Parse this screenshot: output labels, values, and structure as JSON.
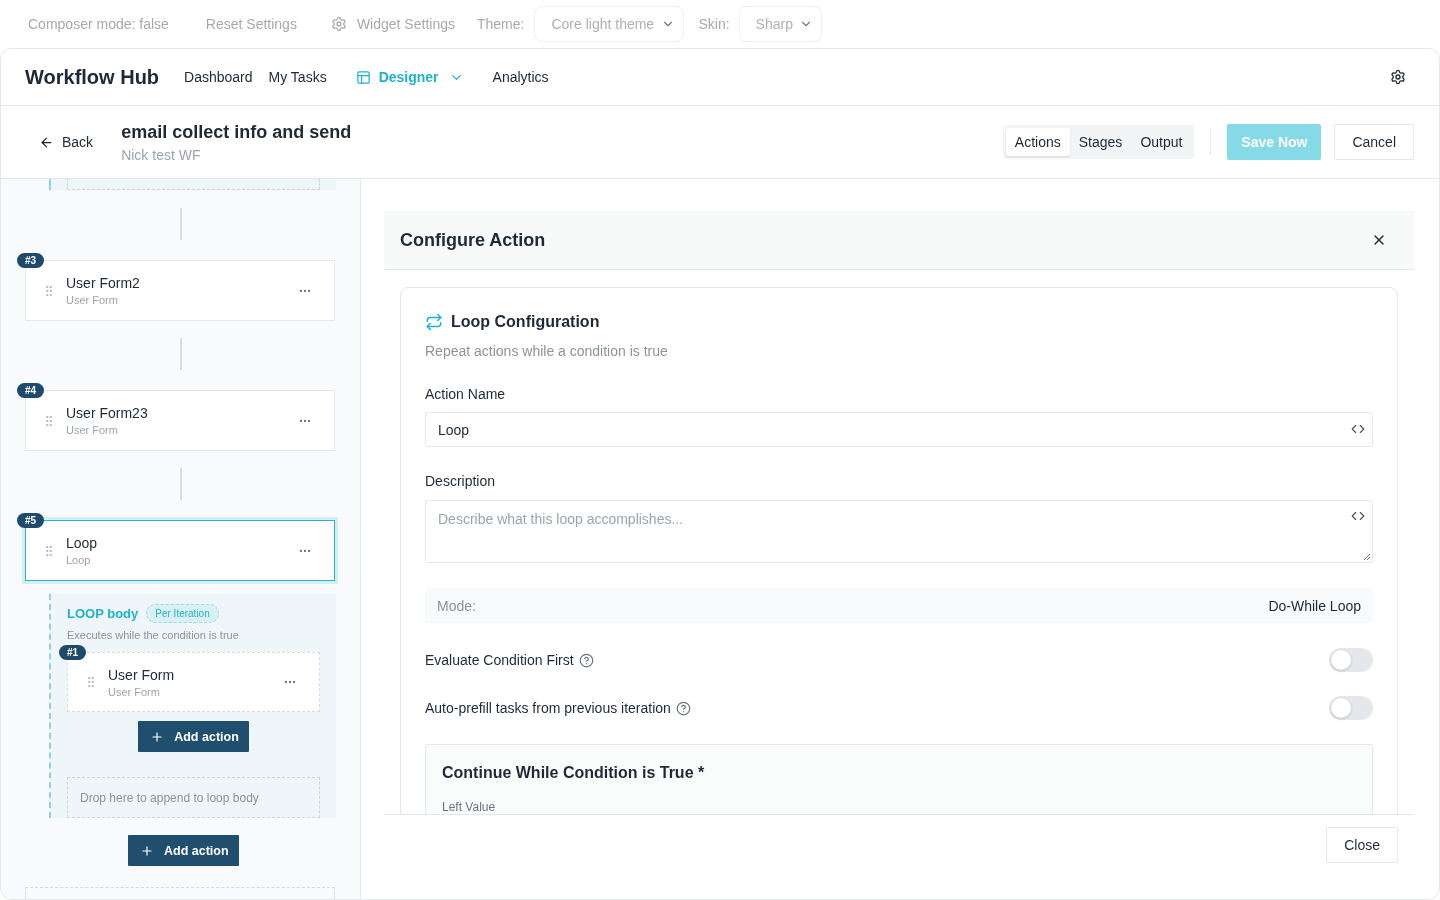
{
  "toolbar": {
    "composer_mode": "Composer mode: false",
    "reset": "Reset Settings",
    "widget_settings": "Widget Settings",
    "theme_label": "Theme:",
    "theme_value": "Core light theme",
    "skin_label": "Skin:",
    "skin_value": "Sharp"
  },
  "app": {
    "title": "Workflow Hub"
  },
  "nav": [
    {
      "label": "Dashboard",
      "kind": "link",
      "selected": false
    },
    {
      "label": "My Tasks",
      "kind": "link",
      "selected": false
    },
    {
      "label": "Designer",
      "kind": "menu",
      "selected": true
    },
    {
      "label": "Analytics",
      "kind": "link",
      "selected": false
    }
  ],
  "workflow": {
    "back": "Back",
    "title": "email collect info and send",
    "subtitle": "Nick test WF"
  },
  "view_tabs": [
    {
      "label": "Actions",
      "selected": true
    },
    {
      "label": "Stages",
      "selected": false
    },
    {
      "label": "Output",
      "selected": false
    }
  ],
  "save_button": {
    "label": "Save Now",
    "disabled": true
  },
  "cancel_button": {
    "label": "Cancel"
  },
  "steps": [
    {
      "kind": "action",
      "badge": "#3",
      "title": "User Form2",
      "subtitle": "User Form",
      "selected": false
    },
    {
      "kind": "action",
      "badge": "#4",
      "title": "User Form23",
      "subtitle": "User Form",
      "selected": false
    },
    {
      "kind": "loop",
      "badge": "#5",
      "title": "Loop",
      "subtitle": "Loop",
      "selected": true,
      "body": {
        "title": "LOOP body",
        "tag": "Per Iteration",
        "description": "Executes while the condition is true",
        "steps": [
          {
            "badge": "#1",
            "title": "User Form",
            "subtitle": "User Form",
            "selected": false
          }
        ],
        "add_label": "Add action",
        "drop_label": "Drop here to append to loop body"
      }
    }
  ],
  "add_action": "Add action",
  "panel": {
    "title": "Configure Action",
    "section_title": "Loop Configuration",
    "section_subtitle": "Repeat actions while a condition is true",
    "fields": [
      {
        "kind": "input",
        "label": "Action Name",
        "value": "Loop"
      },
      {
        "kind": "textarea",
        "label": "Description",
        "placeholder": "Describe what this loop accomplishes..."
      }
    ],
    "mode": {
      "label": "Mode:",
      "value": "Do-While Loop"
    },
    "toggles": [
      {
        "label": "Evaluate Condition First",
        "on": false
      },
      {
        "label": "Auto-prefill tasks from previous iteration",
        "on": false
      }
    ],
    "condition": {
      "title": "Continue While Condition is True *",
      "left_label": "Left Value"
    },
    "close": "Close"
  }
}
